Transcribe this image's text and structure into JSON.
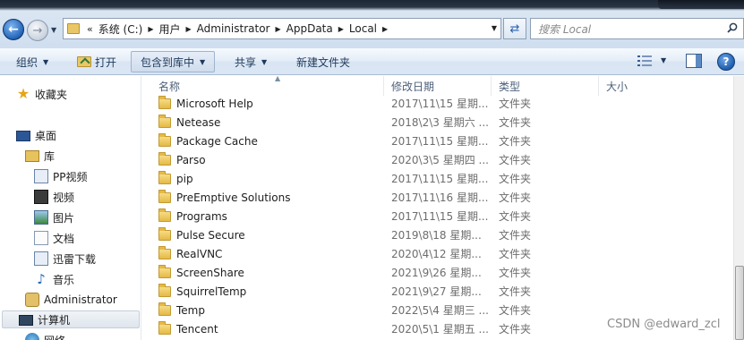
{
  "address": {
    "overflow": "«",
    "segments": [
      "系统 (C:)",
      "用户",
      "Administrator",
      "AppData",
      "Local"
    ],
    "search_placeholder": "搜索 Local"
  },
  "toolbar": {
    "organize": "组织",
    "open": "打开",
    "include_in_library": "包含到库中",
    "share": "共享",
    "new_folder": "新建文件夹"
  },
  "nav": {
    "favorites": "收藏夹",
    "desktop": "桌面",
    "libraries": "库",
    "pp_video": "PP视频",
    "videos": "视频",
    "pictures": "图片",
    "documents": "文档",
    "xunlei": "迅雷下载",
    "music": "音乐",
    "user": "Administrator",
    "computer": "计算机",
    "network": "网络"
  },
  "columns": {
    "name": "名称",
    "modified": "修改日期",
    "type": "类型",
    "size": "大小"
  },
  "files": [
    {
      "name": "Microsoft Help",
      "date": "2017\\11\\15 星期...",
      "type": "文件夹"
    },
    {
      "name": "Netease",
      "date": "2018\\2\\3 星期六 ...",
      "type": "文件夹"
    },
    {
      "name": "Package Cache",
      "date": "2017\\11\\15 星期...",
      "type": "文件夹"
    },
    {
      "name": "Parso",
      "date": "2020\\3\\5 星期四 ...",
      "type": "文件夹"
    },
    {
      "name": "pip",
      "date": "2017\\11\\15 星期...",
      "type": "文件夹"
    },
    {
      "name": "PreEmptive Solutions",
      "date": "2017\\11\\16 星期...",
      "type": "文件夹"
    },
    {
      "name": "Programs",
      "date": "2017\\11\\15 星期...",
      "type": "文件夹"
    },
    {
      "name": "Pulse Secure",
      "date": "2019\\8\\18 星期...",
      "type": "文件夹"
    },
    {
      "name": "RealVNC",
      "date": "2020\\4\\12 星期...",
      "type": "文件夹"
    },
    {
      "name": "ScreenShare",
      "date": "2021\\9\\26 星期...",
      "type": "文件夹"
    },
    {
      "name": "SquirrelTemp",
      "date": "2021\\9\\27 星期...",
      "type": "文件夹"
    },
    {
      "name": "Temp",
      "date": "2022\\5\\4 星期三 ...",
      "type": "文件夹"
    },
    {
      "name": "Tencent",
      "date": "2020\\5\\1 星期五 ...",
      "type": "文件夹"
    }
  ],
  "watermark": "CSDN @edward_zcl",
  "colors": {
    "folder": "#e5b944",
    "toolbar_text": "#1e395b",
    "secondary_text": "#6d6d6d"
  }
}
